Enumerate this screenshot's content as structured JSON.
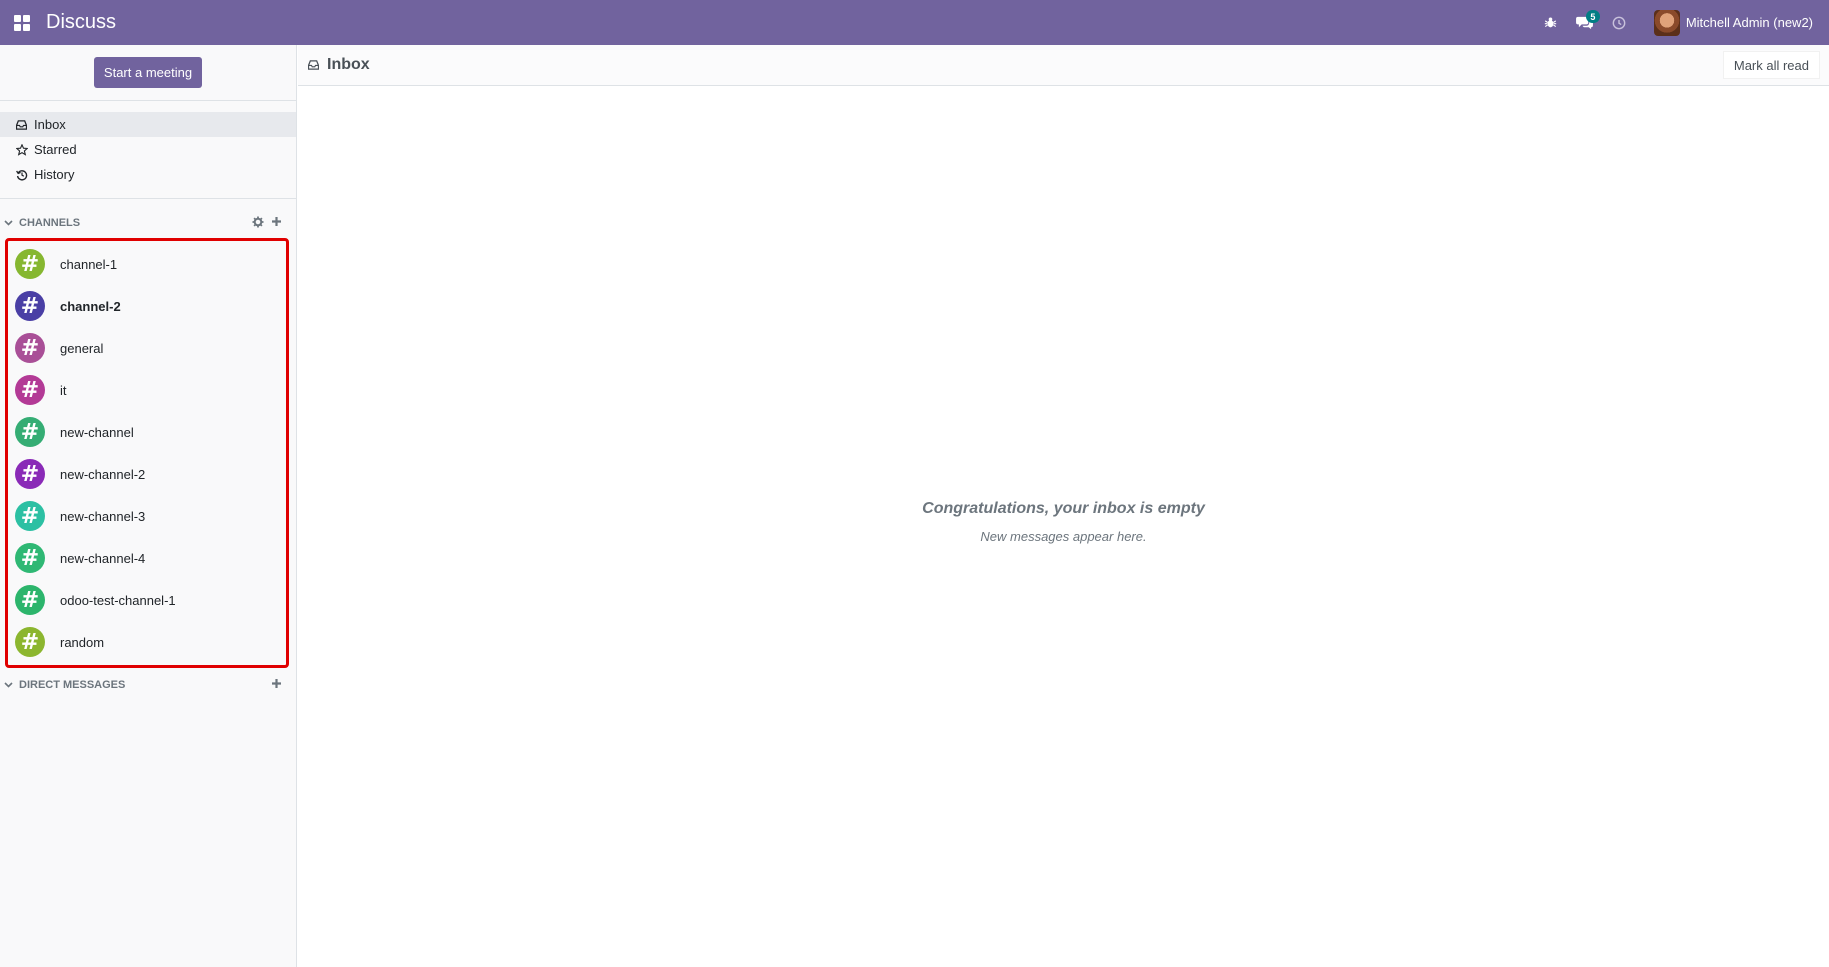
{
  "navbar": {
    "app_title": "Discuss",
    "message_count": "5",
    "user_name": "Mitchell Admin (new2)",
    "color": "#71639e"
  },
  "sidebar": {
    "start_meeting": "Start a meeting",
    "mailboxes": [
      {
        "label": "Inbox",
        "icon": "inbox-icon",
        "active": true
      },
      {
        "label": "Starred",
        "icon": "star-icon"
      },
      {
        "label": "History",
        "icon": "history-icon"
      }
    ],
    "channels_header": "CHANNELS",
    "channels": [
      {
        "name": "channel-1",
        "color": "#86b730",
        "bold": false
      },
      {
        "name": "channel-2",
        "color": "#4a3fa5",
        "bold": true
      },
      {
        "name": "general",
        "color": "#a94f97",
        "bold": false
      },
      {
        "name": "it",
        "color": "#b33a96",
        "bold": false
      },
      {
        "name": "new-channel",
        "color": "#35ad74",
        "bold": false
      },
      {
        "name": "new-channel-2",
        "color": "#8a2ab7",
        "bold": false
      },
      {
        "name": "new-channel-3",
        "color": "#2cc0a3",
        "bold": false
      },
      {
        "name": "new-channel-4",
        "color": "#2fb874",
        "bold": false
      },
      {
        "name": "odoo-test-channel-1",
        "color": "#2cb56c",
        "bold": false
      },
      {
        "name": "random",
        "color": "#8cb62f",
        "bold": false
      }
    ],
    "dm_header": "DIRECT MESSAGES"
  },
  "main": {
    "title": "Inbox",
    "mark_all_read": "Mark all read",
    "empty_title": "Congratulations, your inbox is empty",
    "empty_subtitle": "New messages appear here."
  }
}
